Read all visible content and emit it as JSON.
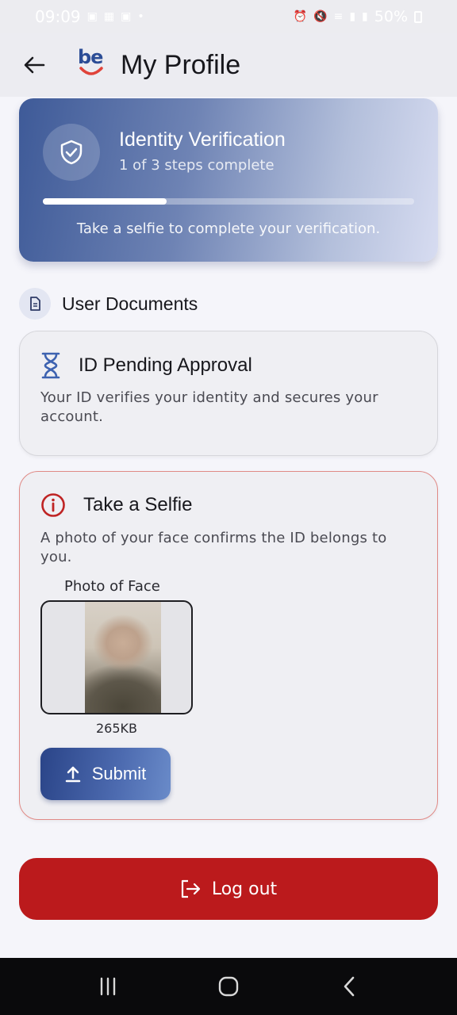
{
  "status_bar": {
    "time": "09:09",
    "battery": "50%",
    "icons": [
      "message-icon",
      "gallery-icon",
      "message-icon",
      "dot-icon",
      "alarm-icon",
      "mute-icon",
      "volte-icon",
      "signal-icon",
      "signal-icon",
      "battery-icon"
    ]
  },
  "app_bar": {
    "logo_text": "be",
    "title": "My Profile",
    "back_icon": "arrow-left-icon"
  },
  "verification": {
    "title": "Identity Verification",
    "subtitle": "1 of 3 steps complete",
    "progress": 0.333,
    "note": "Take a selfie to complete your verification.",
    "icon": "shield-check-icon"
  },
  "documents": {
    "section_title": "User Documents",
    "section_icon": "document-icon",
    "pending": {
      "title": "ID Pending Approval",
      "description": "Your ID verifies your identity and secures your account.",
      "icon": "hourglass-icon"
    },
    "selfie": {
      "title": "Take a Selfie",
      "description": "A photo of your face confirms the ID belongs to you.",
      "icon": "info-circle-icon",
      "photo_label": "Photo of Face",
      "photo_size": "265KB",
      "submit_label": "Submit",
      "submit_icon": "upload-icon"
    }
  },
  "logout": {
    "label": "Log out",
    "icon": "logout-icon"
  },
  "colors": {
    "brand_blue": "#2c4d96",
    "danger_red": "#bb1a1c",
    "selfie_border": "#e08a86"
  },
  "nav_bar": {
    "buttons": [
      "recent-apps-icon",
      "home-icon",
      "back-icon"
    ]
  }
}
